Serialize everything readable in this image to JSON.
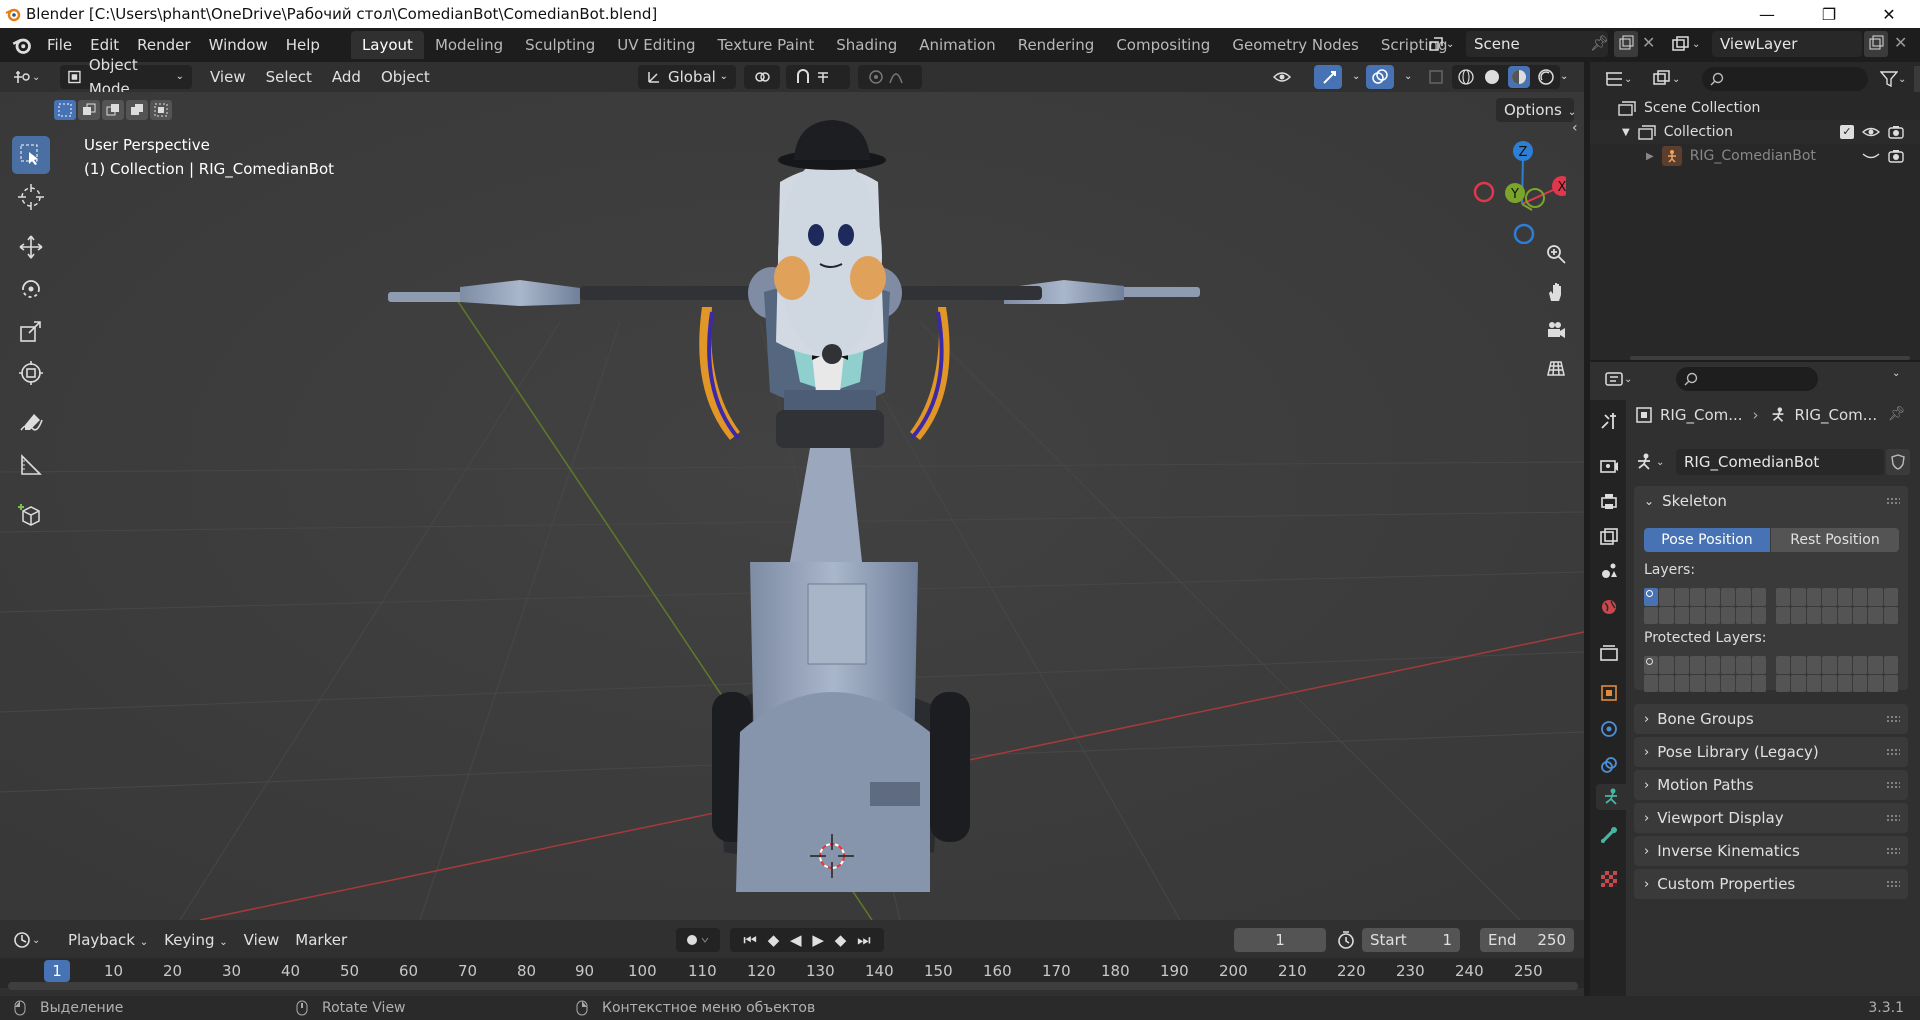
{
  "window": {
    "title": "Blender [C:\\Users\\phant\\OneDrive\\Рабочий стол\\ComedianBot\\ComedianBot.blend]",
    "minimize": "—",
    "maximize": "❐",
    "close": "✕"
  },
  "menu": [
    "File",
    "Edit",
    "Render",
    "Window",
    "Help"
  ],
  "workspaces": [
    "Layout",
    "Modeling",
    "Sculpting",
    "UV Editing",
    "Texture Paint",
    "Shading",
    "Animation",
    "Rendering",
    "Compositing",
    "Geometry Nodes",
    "Scripting"
  ],
  "active_workspace": "Layout",
  "scene": {
    "name": "Scene",
    "view_layer": "ViewLayer"
  },
  "viewport_header": {
    "mode": "Object Mode",
    "menus": [
      "View",
      "Select",
      "Add",
      "Object"
    ],
    "orientation": "Global",
    "options": "Options"
  },
  "viewport": {
    "perspective": "User Perspective",
    "collection_info": "(1) Collection | RIG_ComedianBot",
    "gizmo_z": "Z",
    "gizmo_y": "Y",
    "gizmo_x": "X"
  },
  "timeline": {
    "menus": [
      "Playback",
      "Keying",
      "View",
      "Marker"
    ],
    "current_frame": "1",
    "start_label": "Start",
    "start": "1",
    "end_label": "End",
    "end": "250",
    "ticks": [
      "1",
      "10",
      "20",
      "30",
      "40",
      "50",
      "60",
      "70",
      "80",
      "90",
      "100",
      "110",
      "120",
      "130",
      "140",
      "150",
      "160",
      "170",
      "180",
      "190",
      "200",
      "210",
      "220",
      "230",
      "240",
      "250"
    ]
  },
  "statusbar": {
    "select": "Выделение",
    "rotate": "Rotate View",
    "context": "Контекстное меню объектов",
    "version": "3.3.1"
  },
  "outliner": {
    "scene_collection": "Scene Collection",
    "collection": "Collection",
    "object": "RIG_ComedianBot"
  },
  "properties": {
    "breadcrumb_1": "RIG_Com...",
    "breadcrumb_2": "RIG_Com...",
    "datablock": "RIG_ComedianBot",
    "skeleton": "Skeleton",
    "pose_position": "Pose Position",
    "rest_position": "Rest Position",
    "layers": "Layers:",
    "protected_layers": "Protected Layers:",
    "panels": [
      "Bone Groups",
      "Pose Library (Legacy)",
      "Motion Paths",
      "Viewport Display",
      "Inverse Kinematics",
      "Custom Properties"
    ]
  },
  "colors": {
    "accent": "#4772b3",
    "axis_x": "#e0374d",
    "axis_y": "#7aa52a",
    "axis_z": "#2d7fd6"
  }
}
